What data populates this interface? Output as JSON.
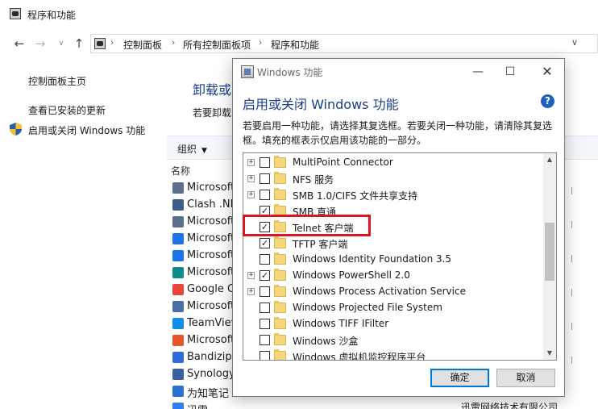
{
  "background_window": {
    "title": "程序和功能",
    "breadcrumbs": [
      "控制面板",
      "所有控制面板项",
      "程序和功能"
    ],
    "sidebar": {
      "links": [
        "控制面板主页",
        "查看已安装的更新",
        "启用或关闭 Windows 功能"
      ]
    },
    "heading": "卸载或",
    "description": "若要卸载",
    "toolbar": {
      "organize_label": "组织"
    },
    "list_header": "名称",
    "programs": [
      {
        "name": "Microsoft",
        "icon": "installer-icon",
        "color": "#5a6f8a"
      },
      {
        "name": "Clash .NE",
        "icon": "clash-icon",
        "color": "#3c5d8a"
      },
      {
        "name": "Microsoft",
        "icon": "installer-icon",
        "color": "#5a6f8a"
      },
      {
        "name": "Microsoft",
        "icon": "onedrive-icon",
        "color": "#1a73e8"
      },
      {
        "name": "Microsoft",
        "icon": "onedrive-icon",
        "color": "#1a73e8"
      },
      {
        "name": "Microsoft",
        "icon": "edge-icon",
        "color": "#0f8a8a"
      },
      {
        "name": "Google Ch",
        "icon": "chrome-icon",
        "color": "#e8453c"
      },
      {
        "name": "Microsoft",
        "icon": "app-icon",
        "color": "#4a6fa5"
      },
      {
        "name": "TeamView",
        "icon": "teamviewer-icon",
        "color": "#0e8ee9"
      },
      {
        "name": "Microsoft",
        "icon": "office-icon",
        "color": "#e3572b"
      },
      {
        "name": "Bandizip",
        "icon": "bandizip-icon",
        "color": "#2f6ad8"
      },
      {
        "name": "Synology",
        "icon": "synology-icon",
        "color": "#3a5f9e"
      },
      {
        "name": "为知笔记 4",
        "icon": "wiz-icon",
        "color": "#2b6fd1"
      },
      {
        "name": "迅雷",
        "icon": "xunlei-icon",
        "color": "#2f7ff0"
      }
    ],
    "footer_text": "迅雷网络技术有限公司"
  },
  "dialog": {
    "title": "Windows 功能",
    "heading": "启用或关闭 Windows 功能",
    "description": "若要启用一种功能，请选择其复选框。若要关闭一种功能，请清除其复选框。填充的框表示仅启用该功能的一部分。",
    "features": [
      {
        "label": "MultiPoint Connector",
        "expandable": true,
        "state": "unchecked"
      },
      {
        "label": "NFS 服务",
        "expandable": true,
        "state": "unchecked"
      },
      {
        "label": "SMB 1.0/CIFS 文件共享支持",
        "expandable": true,
        "state": "unchecked"
      },
      {
        "label": "SMB 直通",
        "expandable": false,
        "state": "checked"
      },
      {
        "label": "Telnet 客户端",
        "expandable": false,
        "state": "checked"
      },
      {
        "label": "TFTP 客户端",
        "expandable": false,
        "state": "checked"
      },
      {
        "label": "Windows Identity Foundation 3.5",
        "expandable": false,
        "state": "unchecked"
      },
      {
        "label": "Windows PowerShell 2.0",
        "expandable": true,
        "state": "checked"
      },
      {
        "label": "Windows Process Activation Service",
        "expandable": true,
        "state": "unchecked"
      },
      {
        "label": "Windows Projected File System",
        "expandable": false,
        "state": "unchecked"
      },
      {
        "label": "Windows TIFF IFilter",
        "expandable": false,
        "state": "unchecked"
      },
      {
        "label": "Windows 沙盒",
        "expandable": false,
        "state": "unchecked"
      },
      {
        "label": "Windows 虚拟机监控程序平台",
        "expandable": false,
        "state": "unchecked"
      }
    ],
    "highlighted_feature_index": 4,
    "ok_label": "确定",
    "cancel_label": "取消"
  },
  "colors": {
    "heading_blue": "#1a3e8a",
    "highlight_red": "#e0141e",
    "focus_blue": "#0078d7",
    "folder_yellow": "#f5d77b"
  }
}
